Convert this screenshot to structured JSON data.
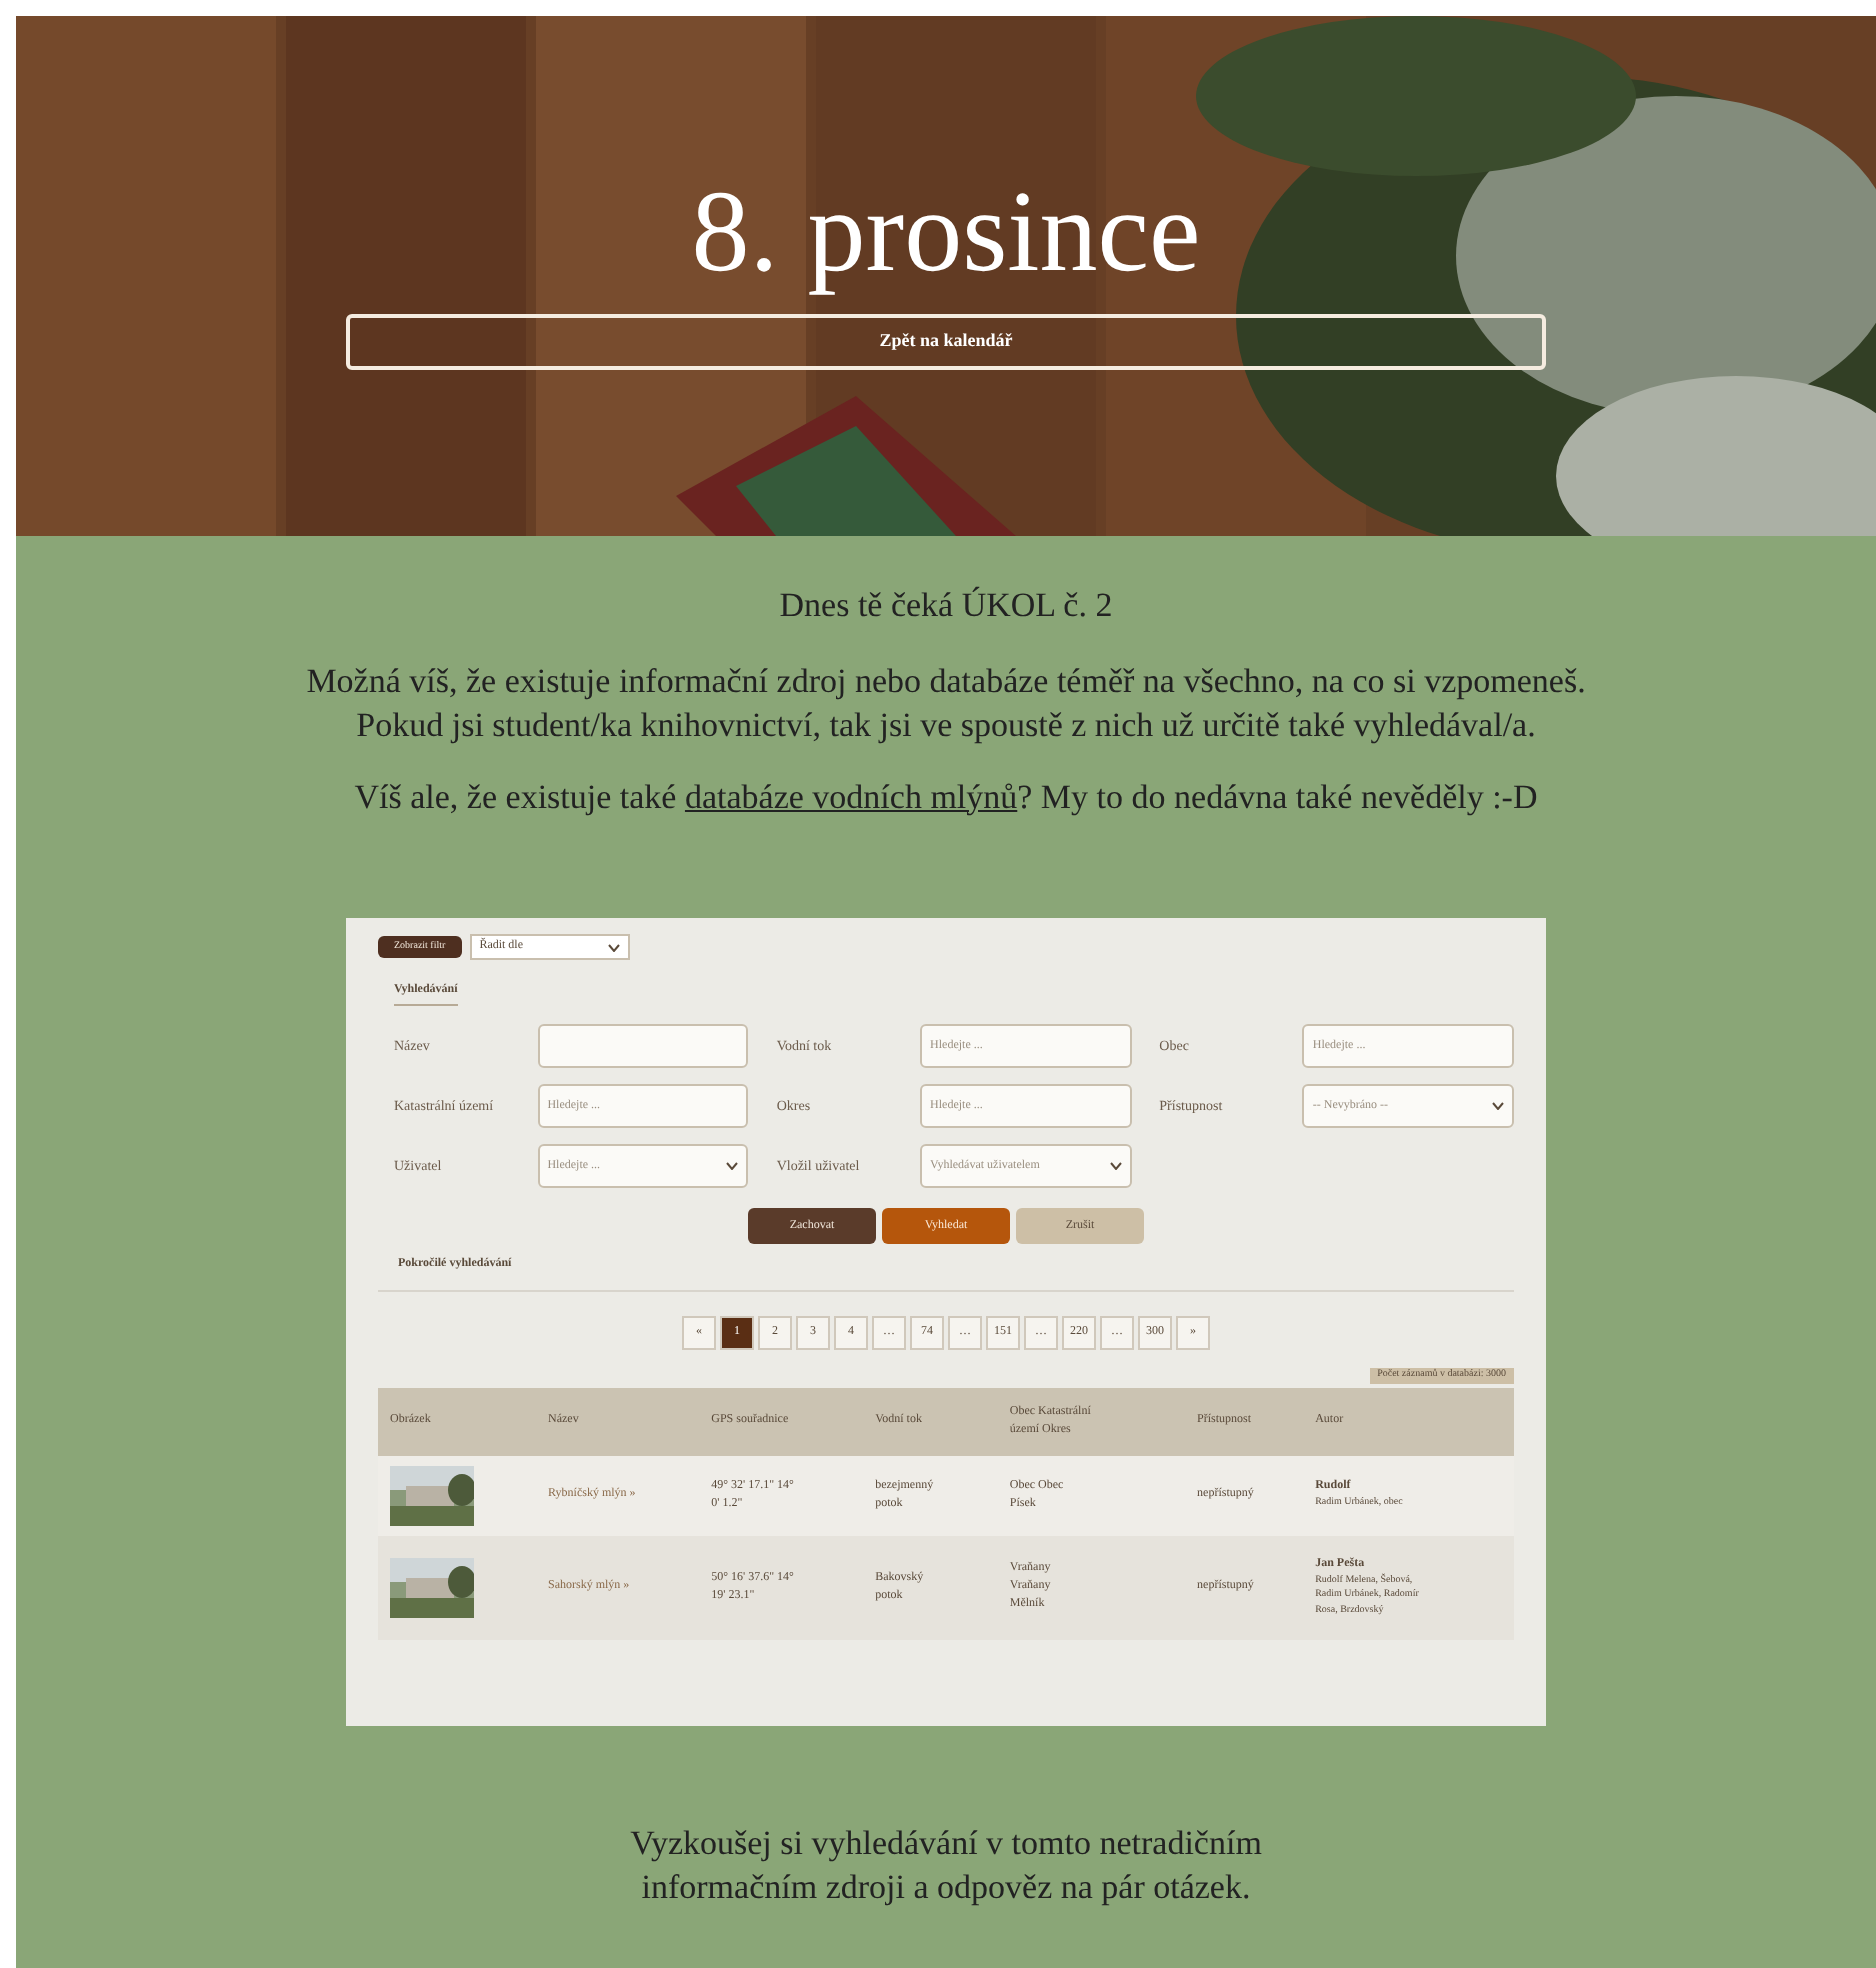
{
  "hero": {
    "title": "8. prosince",
    "back_button": "Zpět na kalendář",
    "kind": "picture"
  },
  "task_heading": "Dnes tě čeká ÚKOL č. 2",
  "intro": [
    "Možná víš, že existuje informační zdroj nebo databáze téměř na všechno, na co si vzpomeneš.",
    "Pokud jsi student/ka knihovnictví, tak jsi ve spoustě z nich už určitě také vyhledával/a."
  ],
  "mill_sentence": {
    "before": "Víš ale, že existuje také ",
    "link": "databáze vodních mlýnů",
    "after": "? My to do nedávna také nevěděly :-D"
  },
  "embedded": {
    "toolbar": {
      "filter_button": "Zobrazit filtr",
      "sort_select": "Řadit dle"
    },
    "tab": "Vyhledávání",
    "fields": [
      {
        "label": "Název",
        "kind": "input"
      },
      {
        "label": "Vodní tok",
        "kind": "input",
        "placeholder": "Hledejte ..."
      },
      {
        "label": "Obec",
        "kind": "input",
        "placeholder": "Hledejte ..."
      },
      {
        "label": "Katastrální území",
        "kind": "input",
        "placeholder": "Hledejte ..."
      },
      {
        "label": "Okres",
        "kind": "input",
        "placeholder": "Hledejte ..."
      },
      {
        "label": "Přístupnost",
        "kind": "select",
        "value": "-- Nevybráno --"
      },
      {
        "label": "Uživatel",
        "kind": "combo",
        "placeholder": "Hledejte ..."
      },
      {
        "label": "Vložil uživatel",
        "kind": "select",
        "value": "Vyhledávat uživatelem"
      }
    ],
    "buttons": [
      {
        "label": "Zachovat",
        "kind": "dark"
      },
      {
        "label": "Vyhledat",
        "kind": "primary"
      },
      {
        "label": "Zrušit",
        "kind": "light"
      }
    ],
    "advanced": "Pokročilé vyhledávání",
    "pages": [
      {
        "label": "«",
        "selected": false
      },
      {
        "label": "1",
        "selected": true
      },
      {
        "label": "2",
        "selected": false
      },
      {
        "label": "3",
        "selected": false
      },
      {
        "label": "4",
        "selected": false
      },
      {
        "label": "…",
        "selected": false
      },
      {
        "label": "74",
        "selected": false
      },
      {
        "label": "…",
        "selected": false
      },
      {
        "label": "151",
        "selected": false
      },
      {
        "label": "…",
        "selected": false
      },
      {
        "label": "220",
        "selected": false
      },
      {
        "label": "…",
        "selected": false
      },
      {
        "label": "300",
        "selected": false
      },
      {
        "label": "»",
        "selected": false
      }
    ],
    "count": "Počet záznamů v databázi: 3000",
    "columns": [
      "Obrázek",
      "Název",
      "GPS souřadnice",
      "Vodní tok",
      "Obec Katastrální území Okres",
      "Přístupnost",
      "Autor"
    ],
    "rows": [
      {
        "name": "Rybníčský mlýn »",
        "gps": "49° 32' 17.1\" 14° 0' 1.2\"",
        "stream": "bezejmenný potok",
        "place": "Obec Obec Písek",
        "access": "nepřístupný",
        "author": "Rudolf",
        "author_note": "Radim Urbánek, obec"
      },
      {
        "name": "Sahorský mlýn »",
        "gps": "50° 16' 37.6\" 14° 19' 23.1\"",
        "stream": "Bakovský potok",
        "place": "Vraňany Vraňany Mělník",
        "access": "nepřístupný",
        "author": "Jan Pešta",
        "author_note": "Rudolf Melena, Šebová, Radim Urbánek, Radomír Rosa, Brzdovský"
      }
    ]
  },
  "outro": [
    "Vyzkoušej si vyhledávání v tomto netradičním",
    "informačním zdroji a odpověz na pár otázek."
  ]
}
